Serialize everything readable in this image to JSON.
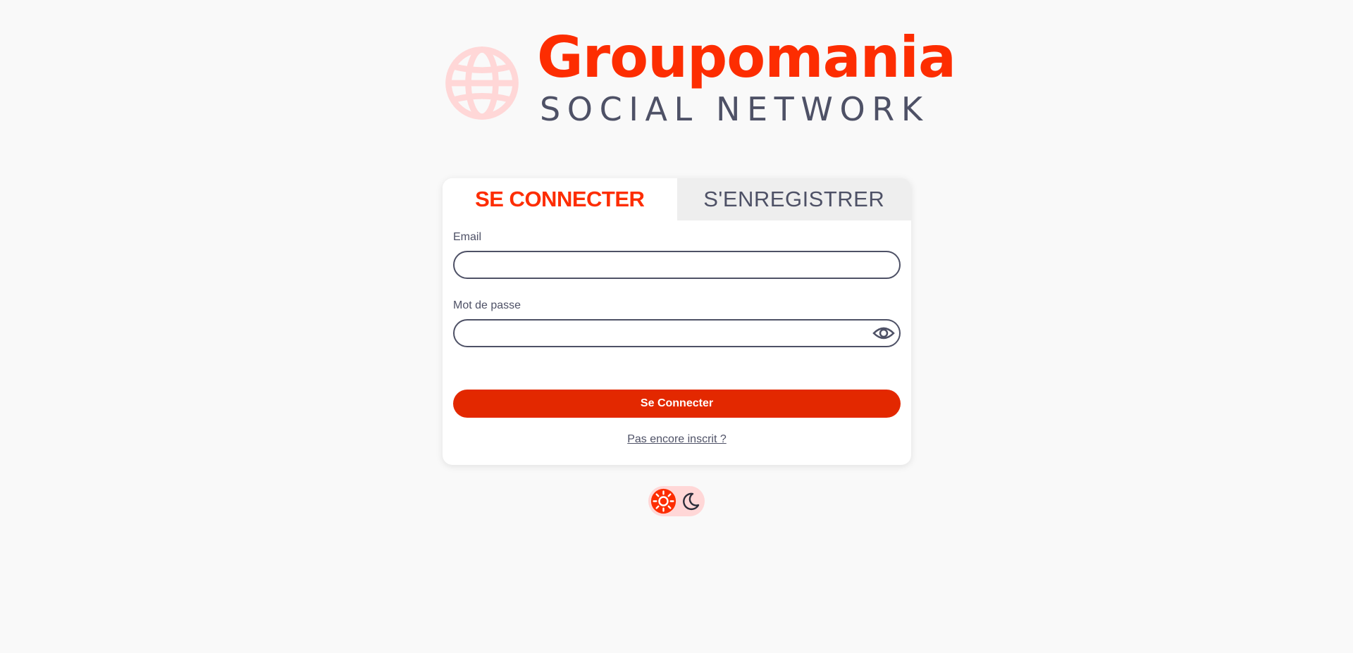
{
  "brand": {
    "name": "Groupomania",
    "tagline": "SOCIAL NETWORK",
    "accent": "#fd2d01",
    "secondary": "#4e5166",
    "globe_color": "#ffd7d7"
  },
  "tabs": [
    {
      "label": "SE CONNECTER",
      "active": true
    },
    {
      "label": "S'ENREGISTRER",
      "active": false
    }
  ],
  "form": {
    "email_label": "Email",
    "email_value": "",
    "password_label": "Mot de passe",
    "password_value": "",
    "password_toggle_icon": "eye-icon",
    "submit_label": "Se Connecter",
    "submit_color": "#e32800",
    "register_link": "Pas encore inscrit ?"
  },
  "theme_toggle": {
    "light_icon": "sun-icon",
    "dark_icon": "moon-icon",
    "selected": "light"
  }
}
